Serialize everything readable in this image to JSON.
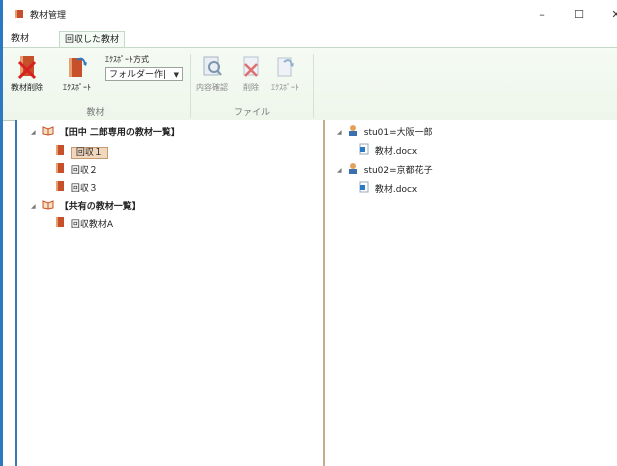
{
  "window": {
    "title": "教材管理",
    "controls": {
      "minimize": "–",
      "maximize": "☐",
      "close": "✕"
    }
  },
  "tabs": [
    {
      "label": "教材"
    },
    {
      "label": "回収した教材"
    }
  ],
  "ribbon": {
    "delete_label": "教材削除",
    "export_label": "ｴｸｽﾎﾟｰﾄ",
    "export_method_label": "ｴｸｽﾎﾟｰﾄ方式",
    "export_method_value": "フォルダー作|",
    "group_material": "教材",
    "check_label": "内容確認",
    "file_delete_label": "削除",
    "file_export_label": "ｴｸｽﾎﾟｰﾄ",
    "group_file": "ファイル"
  },
  "left_tree": {
    "group1": {
      "label": "【田中 二郎専用の教材一覧】",
      "children": [
        "回収１",
        "回収２",
        "回収３"
      ]
    },
    "group2": {
      "label": "【共有の教材一覧】",
      "children": [
        "回収教材A"
      ]
    }
  },
  "right_tree": [
    {
      "student": "stu01=大阪一郎",
      "file": "教材.docx"
    },
    {
      "student": "stu02=京都花子",
      "file": "教材.docx"
    }
  ],
  "colors": {
    "accent": "#2b79c2",
    "selection": "#f2d7bf",
    "ribbon_bg": "#f2f9f0"
  }
}
